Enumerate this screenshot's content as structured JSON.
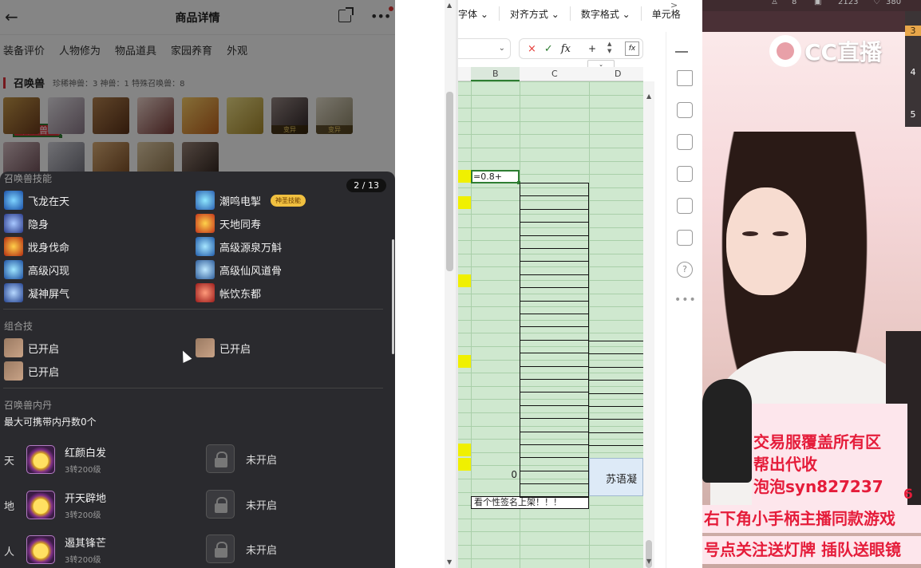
{
  "left": {
    "header": {
      "back": "←",
      "title": "商品详情",
      "more": "•••"
    },
    "tabs": [
      "装备评价",
      "人物修为",
      "物品道具",
      "召唤兽坐骑",
      "家园养育",
      "外观"
    ],
    "summon": {
      "title": "召唤兽",
      "stats": "珍稀神兽：3   神兽：1   特殊召唤兽：8",
      "avatar_tags": [
        "变异",
        "变异"
      ]
    },
    "panel": {
      "counter": "2 / 13",
      "skills_title": "召唤兽技能",
      "skills_left": [
        "飞龙在天",
        "隐身",
        "戕身伐命",
        "高级闪现",
        "凝神屏气"
      ],
      "skills_right": [
        "潮鸣电掣",
        "天地同寿",
        "高级源泉万斛",
        "高级仙风道骨",
        "帐饮东都"
      ],
      "skill_badge": "神圣技能",
      "combo_title": "组合技",
      "combo": [
        "已开启",
        "已开启",
        "已开启"
      ],
      "dan_title": "召唤兽内丹",
      "dan_subtitle": "最大可携带内丹数0个",
      "dan_rows": [
        {
          "side": "天",
          "name": "红颜白发",
          "level": "3转200级",
          "lock": "未开启"
        },
        {
          "side": "地",
          "name": "开天辟地",
          "level": "3转200级",
          "lock": "未开启"
        },
        {
          "side": "人",
          "name": "遏其锋芒",
          "level": "3转200级",
          "lock": "未开启"
        }
      ]
    }
  },
  "sheet": {
    "ribbon": [
      "字体",
      "对齐方式",
      "数字格式",
      "单元格"
    ],
    "formula": {
      "cancel": "×",
      "confirm": "✓",
      "fx": "fx",
      "content": "+"
    },
    "columns": [
      "B",
      "C",
      "D"
    ],
    "active_cell_text": "=0.8+",
    "zero_cell": "0",
    "d_cell_text": "苏语凝",
    "bottom_text": "看个性签名上架！！！",
    "tool_help": "?",
    "tool_more": "•••"
  },
  "stream": {
    "top": [
      "8",
      "2123",
      "380"
    ],
    "side_numbers": [
      "3",
      "4",
      "5"
    ],
    "logo": "CC直播",
    "ad_lines": [
      "交易服覆盖所有区",
      "帮出代收",
      "泡泡syn827237"
    ],
    "ad_small": "6",
    "marquee1": "右下角小手柄主播同款游戏",
    "marquee2": "号点关注送灯牌  插队送眼镜"
  }
}
